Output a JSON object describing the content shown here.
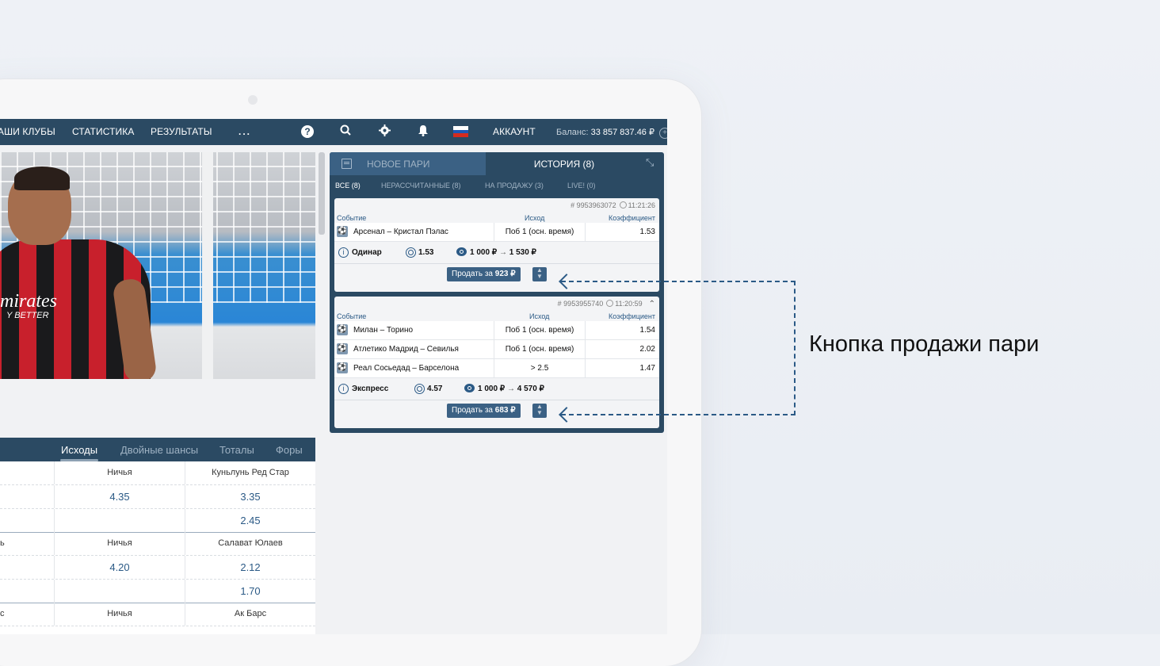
{
  "nav": {
    "items": [
      "АШИ КЛУБЫ",
      "СТАТИСТИКА",
      "РЕЗУЛЬТАТЫ",
      "..."
    ],
    "icons": [
      "help-icon",
      "search-icon",
      "gear-icon",
      "bell-icon",
      "ru-flag-icon"
    ],
    "account": "АККАУНТ",
    "balance_label": "Баланс:",
    "balance_value": "33 857 837.46 ₽"
  },
  "odds": {
    "tabs": [
      "Исходы",
      "Двойные шансы",
      "Тоталы",
      "Форы"
    ],
    "active_tab": "Исходы",
    "rows": [
      {
        "c1": "",
        "c2": "Ничья",
        "c3": "Куньлунь Ред Стар",
        "kind": "label"
      },
      {
        "c1": "",
        "c2": "4.35",
        "c3": "3.35",
        "kind": "value"
      },
      {
        "c1": "",
        "c2": "",
        "c3": "2.45",
        "kind": "value"
      },
      {
        "c1": "ь",
        "c2": "Ничья",
        "c3": "Салават Юлаев",
        "kind": "label"
      },
      {
        "c1": "",
        "c2": "4.20",
        "c3": "2.12",
        "kind": "value"
      },
      {
        "c1": "",
        "c2": "",
        "c3": "1.70",
        "kind": "value"
      },
      {
        "c1": "с",
        "c2": "Ничья",
        "c3": "Ак Барс",
        "kind": "label"
      }
    ]
  },
  "coupon": {
    "tab_new": "НОВОЕ ПАРИ",
    "tab_history": "ИСТОРИЯ (8)",
    "filters": [
      "ВСЕ (8)",
      "НЕРАССЧИТАННЫЕ (8)",
      "НА ПРОДАЖУ (3)",
      "LIVE! (0)"
    ],
    "columns": {
      "event": "Событие",
      "outcome": "Исход",
      "coef": "Коэффициент"
    },
    "bets": [
      {
        "id": "# 9953963072",
        "time": "11:21:26",
        "events": [
          {
            "name": "Арсенал – Кристал Пэлас",
            "outcome": "Поб 1 (осн. время)",
            "coef": "1.53"
          }
        ],
        "type": "Одинар",
        "total_coef": "1.53",
        "stake": "1 000 ₽",
        "payout": "1 530 ₽",
        "sell_label": "Продать за",
        "sell_amount": "923 ₽"
      },
      {
        "id": "# 9953955740",
        "time": "11:20:59",
        "events": [
          {
            "name": "Милан – Торино",
            "outcome": "Поб 1 (осн. время)",
            "coef": "1.54"
          },
          {
            "name": "Атлетико Мадрид – Севилья",
            "outcome": "Поб 1 (осн. время)",
            "coef": "2.02"
          },
          {
            "name": "Реал Сосьедад – Барселона",
            "outcome": "> 2.5",
            "coef": "1.47"
          }
        ],
        "type": "Экспресс",
        "total_coef": "4.57",
        "stake": "1 000 ₽",
        "payout": "4 570 ₽",
        "sell_label": "Продать за",
        "sell_amount": "683 ₽"
      }
    ]
  },
  "photo": {
    "sponsor": "mirates",
    "sponsor_sub": "Y BETTER"
  },
  "annotation": "Кнопка продажи пари",
  "colors": {
    "nav": "#2b4a63",
    "accent": "#2b5a86",
    "tab_active": "#3b6184"
  }
}
